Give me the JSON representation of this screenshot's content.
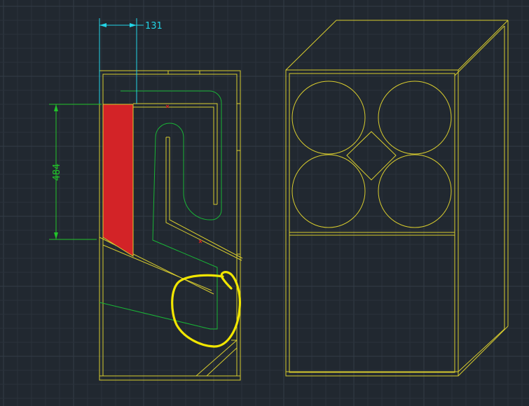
{
  "drawing": {
    "dimensions": {
      "horizontal": "131",
      "vertical": "484"
    },
    "colors": {
      "background": "#212830",
      "grid_minor": "#2a323b",
      "grid_major": "#333c46",
      "outline": "#d8cc2e",
      "path": "#19b536",
      "dimension_green": "#22c42a",
      "dimension_cyan": "#22d4e6",
      "fill_red": "#d32327",
      "markup_yellow": "#f1e600",
      "marker_red": "#e02020"
    }
  }
}
